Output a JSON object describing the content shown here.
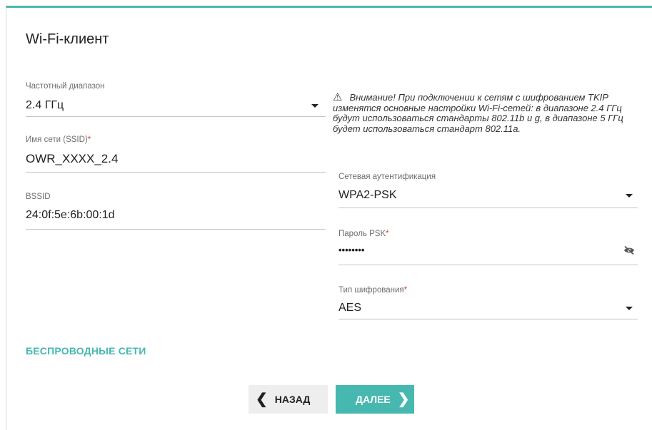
{
  "title": "Wi-Fi-клиент",
  "fields": {
    "band": {
      "label": "Частотный диапазон",
      "value": "2.4 ГГц"
    },
    "ssid": {
      "label": "Имя сети (SSID)",
      "required_mark": "*",
      "value": "OWR_XXXX_2.4"
    },
    "bssid": {
      "label": "BSSID",
      "value": "24:0f:5e:6b:00:1d"
    },
    "auth": {
      "label": "Сетевая аутентификация",
      "value": "WPA2-PSK"
    },
    "psk": {
      "label": "Пароль PSK",
      "required_mark": "*",
      "value": "••••••••"
    },
    "cipher": {
      "label": "Тип шифрования",
      "required_mark": "*",
      "value": "AES"
    }
  },
  "warning": {
    "icon": "⚠",
    "text": "Внимание! При подключении к сетям с шифрованием TKIP изменятся основные настройки Wi-Fi-сетей: в диапазоне 2.4 ГГц будут использоваться стандарты 802.11b и g, в диапазоне 5 ГГц будет использоваться стандарт 802.11a."
  },
  "link": {
    "label": "БЕСПРОВОДНЫЕ СЕТИ"
  },
  "buttons": {
    "back": {
      "label": "НАЗАД",
      "icon": "❮"
    },
    "next": {
      "label": "ДАЛЕЕ",
      "icon": "❯"
    }
  },
  "colors": {
    "accent": "#47b8b0",
    "required": "#e53935"
  }
}
